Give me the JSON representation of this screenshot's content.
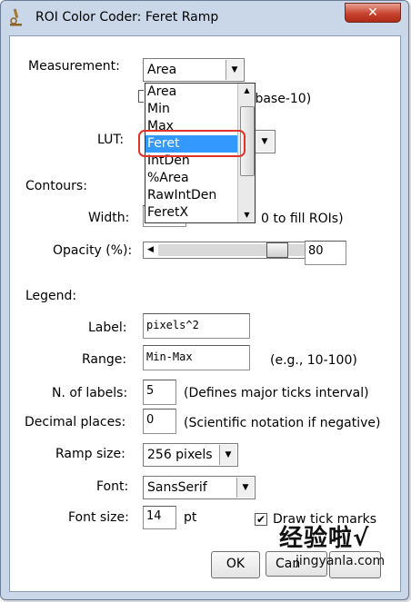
{
  "window": {
    "title": "ROI Color Coder: Feret Ramp",
    "close_label": "✕"
  },
  "measurement": {
    "label": "Measurement:",
    "selected": "Area",
    "options": [
      "Area",
      "Min",
      "Max",
      "Feret",
      "IntDen",
      "%Area",
      "RawIntDen",
      "FeretX"
    ],
    "highlighted": "Feret"
  },
  "log_scale": {
    "suffix": "(base-10)"
  },
  "lut": {
    "label": "LUT:"
  },
  "contours": {
    "heading": "Contours:",
    "width_label": "Width:",
    "width_hint_tail": "0 to fill ROIs)",
    "opacity_label": "Opacity (%):",
    "opacity_value": "80",
    "opacity_fraction": 0.8
  },
  "legend": {
    "heading": "Legend:",
    "label_label": "Label:",
    "label_value": "pixels^2",
    "range_label": "Range:",
    "range_value": "Min-Max",
    "range_hint": "(e.g., 10-100)",
    "nlabels_label": "N. of labels:",
    "nlabels_value": "5",
    "nlabels_hint": "(Defines major ticks interval)",
    "decimal_label": "Decimal places:",
    "decimal_value": "0",
    "decimal_hint": "(Scientific notation if negative)",
    "ramp_label": "Ramp size:",
    "ramp_value": "256 pixels",
    "font_label": "Font:",
    "font_value": "SansSerif",
    "fontsize_label": "Font size:",
    "fontsize_value": "14",
    "fontsize_unit": "pt",
    "ticks_label": "Draw tick marks",
    "ticks_checked": "✔"
  },
  "buttons": {
    "ok": "OK",
    "cancel": "Can"
  },
  "watermark": {
    "cn": "经验啦√",
    "url": "jingyanla.com"
  },
  "colors": {
    "selection": "#3399ff",
    "highlight_ring": "#e0342a",
    "frame": "#c9d7e9",
    "close": "#c7442f"
  }
}
